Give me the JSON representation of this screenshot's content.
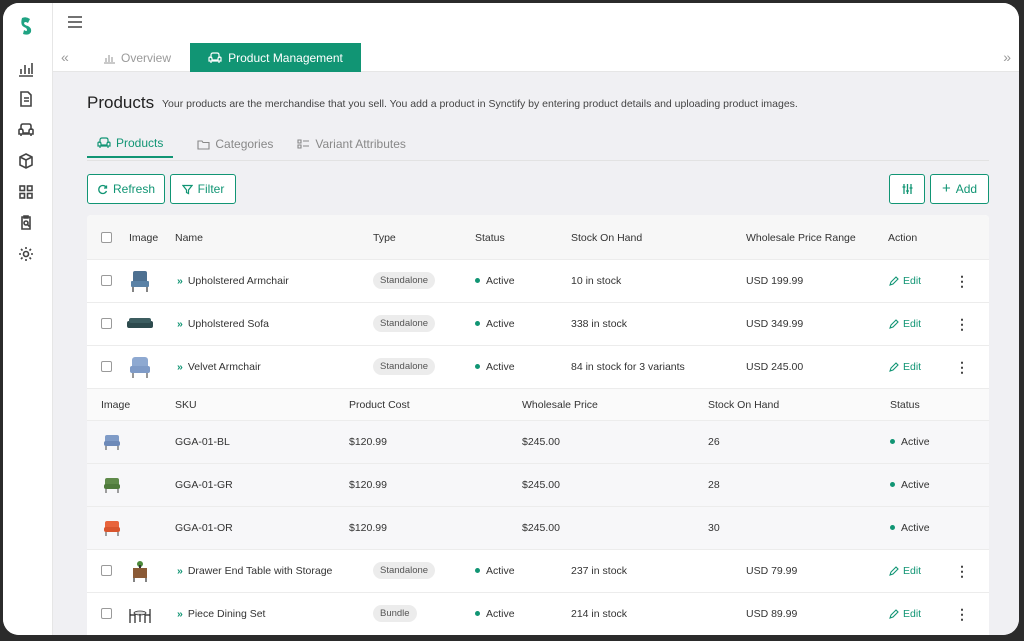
{
  "tabs": {
    "overview": "Overview",
    "product_management": "Product Management"
  },
  "page": {
    "title": "Products",
    "description": "Your products are the merchandise that you sell. You add a product in Synctify by entering product details and uploading product images."
  },
  "subtabs": [
    "Products",
    "Categories",
    "Variant Attributes"
  ],
  "toolbar": {
    "refresh": "Refresh",
    "filter": "Filter",
    "add": "Add"
  },
  "table": {
    "headers": [
      "Image",
      "Name",
      "Type",
      "Status",
      "Stock On Hand",
      "Wholesale Price Range",
      "Action"
    ],
    "rows": [
      {
        "name": "Upholstered Armchair",
        "type": "Standalone",
        "status": "Active",
        "stock": "10 in stock",
        "price": "USD 199.99",
        "action": "Edit"
      },
      {
        "name": "Upholstered Sofa",
        "type": "Standalone",
        "status": "Active",
        "stock": "338 in stock",
        "price": "USD 349.99",
        "action": "Edit"
      },
      {
        "name": "Velvet Armchair",
        "type": "Standalone",
        "status": "Active",
        "stock": "84 in stock for 3 variants",
        "price": "USD 245.00",
        "action": "Edit"
      },
      {
        "name": "Drawer End Table with Storage",
        "type": "Standalone",
        "status": "Active",
        "stock": "237 in stock",
        "price": "USD 79.99",
        "action": "Edit"
      },
      {
        "name": "Piece Dining Set",
        "type": "Bundle",
        "status": "Active",
        "stock": "214 in stock",
        "price": "USD 89.99",
        "action": "Edit"
      }
    ],
    "variant_headers": [
      "Image",
      "SKU",
      "Product Cost",
      "Wholesale Price",
      "Stock On Hand",
      "Status"
    ],
    "variants": [
      {
        "sku": "GGA-01-BL",
        "cost": "$120.99",
        "price": "$245.00",
        "stock": "26",
        "status": "Active",
        "color": "#7f9bc7"
      },
      {
        "sku": "GGA-01-GR",
        "cost": "$120.99",
        "price": "$245.00",
        "stock": "28",
        "status": "Active",
        "color": "#5f8a4a"
      },
      {
        "sku": "GGA-01-OR",
        "cost": "$120.99",
        "price": "$245.00",
        "stock": "30",
        "status": "Active",
        "color": "#e8643c"
      }
    ]
  },
  "colors": {
    "accent": "#119574",
    "background": "#f0f0f3"
  }
}
